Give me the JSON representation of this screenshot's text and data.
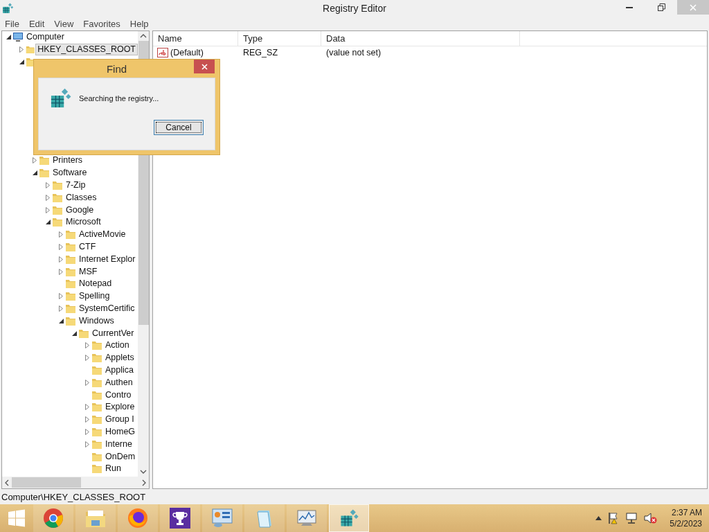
{
  "window": {
    "title": "Registry Editor"
  },
  "menu": [
    "File",
    "Edit",
    "View",
    "Favorites",
    "Help"
  ],
  "tree": [
    {
      "label": "Computer",
      "kind": "computer",
      "expanded": true,
      "selected": false,
      "children": [
        {
          "label": "HKEY_CLASSES_ROOT",
          "expanded": false,
          "selected": true
        },
        {
          "expanded": true,
          "children": [
            {
              "label": "Printers",
              "expanded": false,
              "selected": false
            },
            {
              "label": "Software",
              "expanded": true,
              "selected": false,
              "children": [
                {
                  "label": "7-Zip",
                  "expanded": false,
                  "selected": false
                },
                {
                  "label": "Classes",
                  "expanded": false,
                  "selected": false
                },
                {
                  "label": "Google",
                  "expanded": false,
                  "selected": false
                },
                {
                  "label": "Microsoft",
                  "expanded": true,
                  "selected": false,
                  "children": [
                    {
                      "label": "ActiveMovie",
                      "expanded": false,
                      "selected": false
                    },
                    {
                      "label": "CTF",
                      "expanded": false,
                      "selected": false
                    },
                    {
                      "label": "Internet Explor",
                      "expanded": false,
                      "selected": false
                    },
                    {
                      "label": "MSF",
                      "expanded": false,
                      "selected": false
                    },
                    {
                      "label": "Notepad",
                      "selected": false
                    },
                    {
                      "label": "Spelling",
                      "expanded": false,
                      "selected": false
                    },
                    {
                      "label": "SystemCertific",
                      "expanded": false,
                      "selected": false
                    },
                    {
                      "label": "Windows",
                      "expanded": true,
                      "selected": false,
                      "children": [
                        {
                          "label": "CurrentVer",
                          "expanded": true,
                          "selected": false,
                          "children": [
                            {
                              "label": "Action",
                              "expanded": false,
                              "selected": false
                            },
                            {
                              "label": "Applets",
                              "expanded": false,
                              "selected": false
                            },
                            {
                              "label": "Applica",
                              "selected": false
                            },
                            {
                              "label": "Authen",
                              "expanded": false,
                              "selected": false
                            },
                            {
                              "label": "Contro",
                              "selected": false
                            },
                            {
                              "label": "Explore",
                              "expanded": false,
                              "selected": false
                            },
                            {
                              "label": "Group I",
                              "expanded": false,
                              "selected": false
                            },
                            {
                              "label": "HomeG",
                              "expanded": false,
                              "selected": false
                            },
                            {
                              "label": "Interne",
                              "expanded": false,
                              "selected": false
                            },
                            {
                              "label": "OnDem",
                              "selected": false
                            },
                            {
                              "label": "Run",
                              "selected": false
                            }
                          ]
                        }
                      ]
                    }
                  ]
                }
              ]
            }
          ]
        }
      ]
    }
  ],
  "list": {
    "columns": [
      "Name",
      "Type",
      "Data"
    ],
    "rows": [
      {
        "name": "(Default)",
        "type": "REG_SZ",
        "data": "(value not set)"
      }
    ]
  },
  "status_bar": "Computer\\HKEY_CLASSES_ROOT",
  "dialog": {
    "title": "Find",
    "message": "Searching the registry...",
    "button": "Cancel"
  },
  "taskbar": {
    "apps": [
      {
        "kind": "chrome",
        "selected": false
      },
      {
        "kind": "files",
        "selected": false
      },
      {
        "kind": "firefox",
        "selected": false
      },
      {
        "kind": "trophy",
        "selected": false
      },
      {
        "kind": "control",
        "selected": false
      },
      {
        "kind": "notepad",
        "selected": false
      },
      {
        "kind": "monitor",
        "selected": false
      },
      {
        "kind": "regedit",
        "selected": true
      }
    ],
    "clock": {
      "time": "2:37 AM",
      "date": "5/2/2023"
    }
  }
}
